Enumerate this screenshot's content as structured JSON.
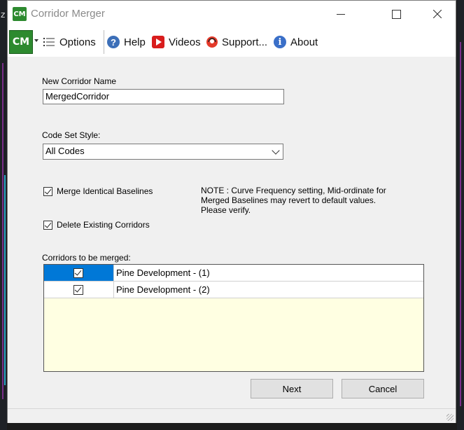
{
  "window": {
    "title": "Corridor Merger",
    "logo_text": "CM"
  },
  "toolbar": {
    "logo_text": "CM",
    "options_label": "Options",
    "help_label": "Help",
    "videos_label": "Videos",
    "support_label": "Support...",
    "about_label": "About"
  },
  "form": {
    "name_label": "New Corridor Name",
    "name_value": "MergedCorridor",
    "codeset_label": "Code Set Style:",
    "codeset_value": "All Codes",
    "merge_baselines_label": "Merge Identical Baselines",
    "merge_baselines_checked": true,
    "delete_corridors_label": "Delete Existing Corridors",
    "delete_corridors_checked": true,
    "note_text": "NOTE : Curve Frequency setting, Mid-ordinate for Merged Baselines may revert to default values. Please verify.",
    "corridors_label": "Corridors to be merged:"
  },
  "corridors": [
    {
      "name": "Pine Development - (1)",
      "checked": true,
      "selected": true
    },
    {
      "name": "Pine Development - (2)",
      "checked": true,
      "selected": false
    }
  ],
  "buttons": {
    "next_label": "Next",
    "cancel_label": "Cancel"
  },
  "colors": {
    "selection": "#0078d7",
    "grid_background": "#ffffe2",
    "brand_green": "#2d8a2f"
  }
}
